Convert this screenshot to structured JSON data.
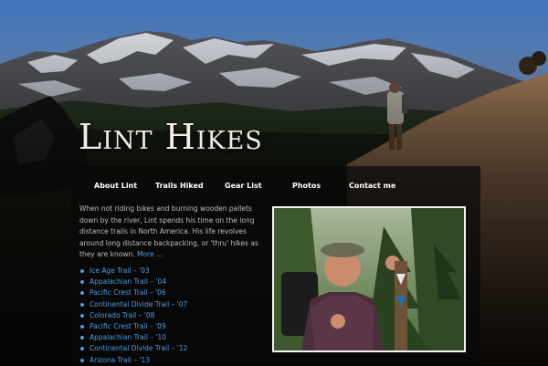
{
  "site": {
    "title": "Lint Hikes"
  },
  "nav": {
    "items": [
      {
        "label": "About Lint"
      },
      {
        "label": "Trails Hiked"
      },
      {
        "label": "Gear List"
      },
      {
        "label": "Photos"
      },
      {
        "label": "Contact me"
      }
    ]
  },
  "intro": {
    "text": "When not riding bikes and burning wooden pallets down by the river, Lint spends his time on the long distance trails in North America. His life revolves around long distance backpacking, or 'thru' hikes as they are known.",
    "more": "More …"
  },
  "trails": [
    "Ice Age Trail – '03",
    "Appalachian Trail – '04",
    "Pacific Crest Trail – '06",
    "Continental Divide Trail – '07",
    "Colorado Trail – '08",
    "Pacific Crest Trail – '09",
    "Appalachian Trail – '10",
    "Continental Divide Trail – '12",
    "Arizona Trail – '13"
  ],
  "colors": {
    "sky": "#4a7fc4",
    "link": "#4f9cde",
    "panel": "#080808"
  }
}
